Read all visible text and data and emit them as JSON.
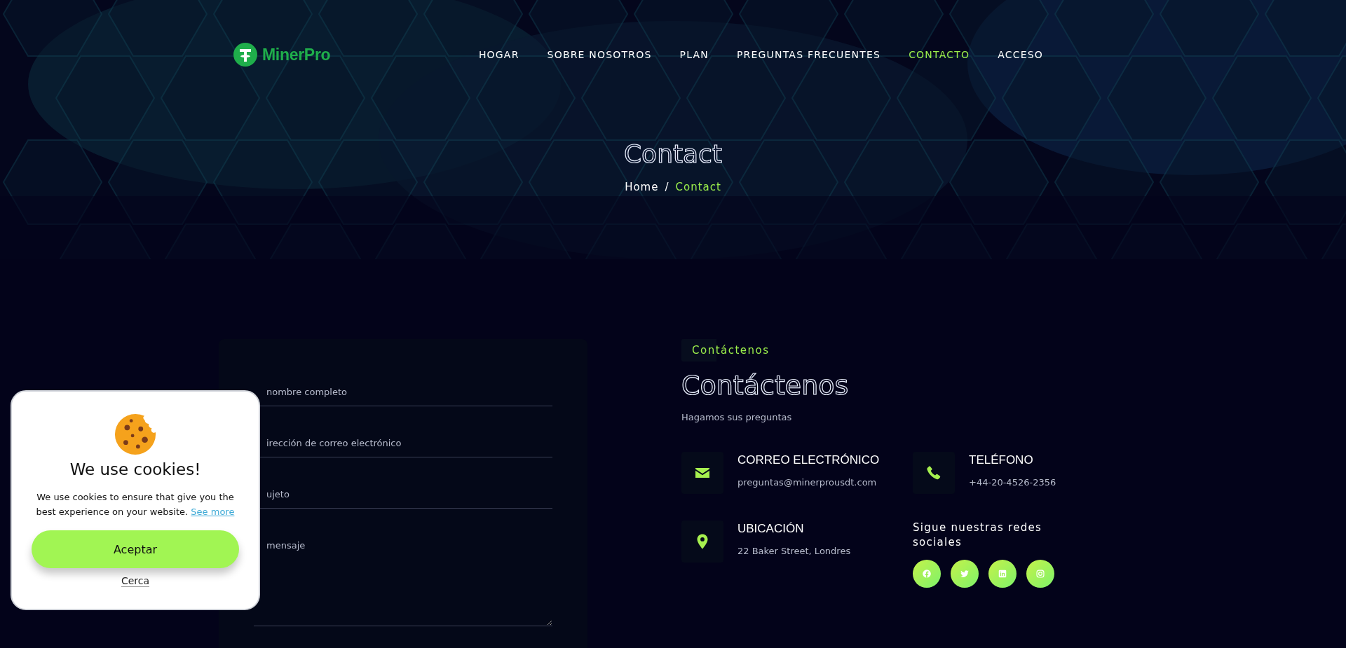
{
  "header": {
    "logo": "MinerPro",
    "nav": [
      {
        "label": "HOGAR",
        "selected": false
      },
      {
        "label": "SOBRE NOSOTROS",
        "selected": false
      },
      {
        "label": "PLAN",
        "selected": false
      },
      {
        "label": "PREGUNTAS FRECUENTES",
        "selected": false
      },
      {
        "label": "CONTACTO",
        "selected": true
      },
      {
        "label": "ACCESO",
        "selected": false
      }
    ]
  },
  "hero": {
    "title": "Contact",
    "separator": "/",
    "breadcrumb": [
      {
        "label": "Home",
        "selected": false
      },
      {
        "label": "Contact",
        "selected": true
      }
    ]
  },
  "form": {
    "fields": [
      {
        "kind": "input",
        "placeholder": "nombre completo"
      },
      {
        "kind": "input",
        "placeholder": "irección de correo electrónico"
      },
      {
        "kind": "input",
        "placeholder": "ujeto"
      },
      {
        "kind": "textarea",
        "placeholder": "mensaje"
      }
    ]
  },
  "contact": {
    "tag": "Contáctenos",
    "heading": "Contáctenos",
    "subtitle": "Hagamos sus preguntas",
    "items": [
      {
        "kind": "email",
        "title": "CORREO ELECTRÓNICO",
        "value": "preguntas@minerprousdt.com"
      },
      {
        "kind": "phone",
        "title": "TELÉFONO",
        "value": "+44-20-4526-2356"
      },
      {
        "kind": "location",
        "title": "UBICACIÓN",
        "value": "22 Baker Street, Londres"
      }
    ],
    "social": {
      "title": "Sigue nuestras redes sociales",
      "links": [
        {
          "kind": "facebook"
        },
        {
          "kind": "twitter"
        },
        {
          "kind": "linkedin"
        },
        {
          "kind": "instagram"
        }
      ]
    }
  },
  "cookie": {
    "title": "We use cookies!",
    "text": "We use cookies to ensure that give you the best experience on your website.",
    "link": "See more",
    "accept": "Aceptar",
    "close": "Cerca"
  }
}
